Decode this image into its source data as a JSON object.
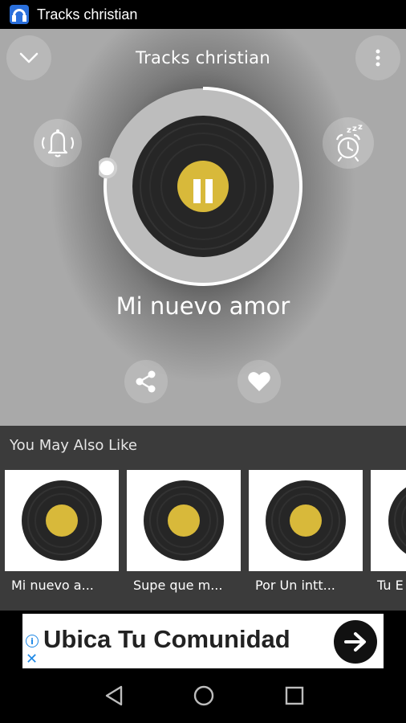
{
  "status_bar": {
    "app_title": "Tracks christian"
  },
  "header": {
    "title": "Tracks christian"
  },
  "player": {
    "song_title": "Mi nuevo amor",
    "progress": 0.78,
    "state": "playing",
    "icons": {
      "collapse": "chevron-down-icon",
      "menu": "more-vertical-icon",
      "alarm": "bell-ringing-icon",
      "sleep_timer": "alarm-clock-sleep-icon",
      "play_pause": "pause-icon",
      "share": "share-icon",
      "favorite": "heart-icon"
    }
  },
  "recommendations": {
    "title": "You May Also Like",
    "items": [
      {
        "label": "Mi nuevo a..."
      },
      {
        "label": "Supe que m..."
      },
      {
        "label": "Por Un intt..."
      },
      {
        "label": "Tu E"
      }
    ]
  },
  "ad": {
    "text": "Ubica Tu Comunidad",
    "info_icon": "i",
    "close_icon": "✕"
  },
  "nav": {
    "back": "back-triangle-icon",
    "home": "home-circle-icon",
    "recents": "recents-square-icon"
  },
  "colors": {
    "accent_gold": "#d8b93a",
    "card_bg": "#ffffff",
    "section_bg": "#3b3b3b"
  }
}
